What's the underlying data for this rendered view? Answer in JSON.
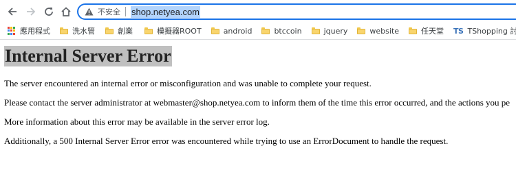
{
  "browser": {
    "security_label": "不安全",
    "url": "shop.netyea.com"
  },
  "bookmarks": [
    {
      "label": "應用程式",
      "icon": "apps-grid-icon"
    },
    {
      "label": "洗水管",
      "icon": "folder-icon"
    },
    {
      "label": "創業",
      "icon": "folder-icon"
    },
    {
      "label": "模擬器ROOT",
      "icon": "folder-icon"
    },
    {
      "label": "android",
      "icon": "folder-icon"
    },
    {
      "label": "btccoin",
      "icon": "folder-icon"
    },
    {
      "label": "jquery",
      "icon": "folder-icon"
    },
    {
      "label": "website",
      "icon": "folder-icon"
    },
    {
      "label": "任天堂",
      "icon": "folder-icon"
    },
    {
      "label": "TShopping 討論區...",
      "icon": "tshopping-icon"
    }
  ],
  "page": {
    "title": "Internal Server Error",
    "paragraphs": [
      "The server encountered an internal error or misconfiguration and was unable to complete your request.",
      "Please contact the server administrator at webmaster@shop.netyea.com to inform them of the time this error occurred, and the actions you pe",
      "More information about this error may be available in the server error log.",
      "Additionally, a 500 Internal Server Error error was encountered while trying to use an ErrorDocument to handle the request."
    ]
  },
  "colors": {
    "omnibox_border": "#1a73e8",
    "url_selection": "#b3d4fc",
    "title_highlight": "#c0c0c0"
  }
}
